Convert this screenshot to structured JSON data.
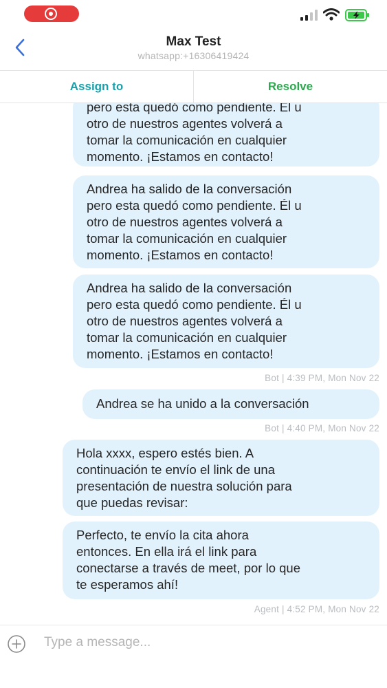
{
  "header": {
    "contact_name": "Max Test",
    "contact_channel": "whatsapp:+16306419424"
  },
  "actions": {
    "assign_label": "Assign to",
    "resolve_label": "Resolve"
  },
  "messages": [
    {
      "text": "pero esta quedó como pendiente. Él u\notro de nuestros agentes volverá a\ntomar la comunicación en cualquier\nmomento. ¡Estamos en contacto!"
    },
    {
      "text": "Andrea ha salido de la conversación\npero esta quedó como pendiente. Él u\notro de nuestros agentes volverá a\ntomar la comunicación en cualquier\nmomento. ¡Estamos en contacto!"
    },
    {
      "text": "Andrea ha salido de la conversación\npero esta quedó como pendiente. Él u\notro de nuestros agentes volverá a\ntomar la comunicación en cualquier\nmomento. ¡Estamos en contacto!",
      "meta": "Bot | 4:39 PM, Mon Nov 22"
    },
    {
      "text": "Andrea se ha unido a la conversación",
      "meta": "Bot | 4:40 PM, Mon Nov 22"
    },
    {
      "text": "Hola xxxx, espero estés bien. A\ncontinuación te envío el link de una\npresentación de nuestra solución para\nque puedas revisar:"
    },
    {
      "text": "Perfecto, te envío la cita ahora\nentonces. En ella irá el link para\nconectarse a través de meet, por lo que\nte esperamos ahí!",
      "meta": "Agent | 4:52 PM, Mon Nov 22"
    }
  ],
  "composer": {
    "placeholder": "Type a message..."
  },
  "icons": {
    "back": "chevron-left-icon",
    "record": "screen-record-icon",
    "signal": "cellular-signal-icon",
    "wifi": "wifi-icon",
    "battery": "battery-charging-icon",
    "add": "plus-circle-icon"
  },
  "colors": {
    "bubble": "#e2f2fc",
    "assign": "#1aa0aa",
    "resolve": "#2fa84f",
    "back": "#3a6fd8",
    "record": "#e63b3b",
    "battery": "#3cc84a"
  }
}
